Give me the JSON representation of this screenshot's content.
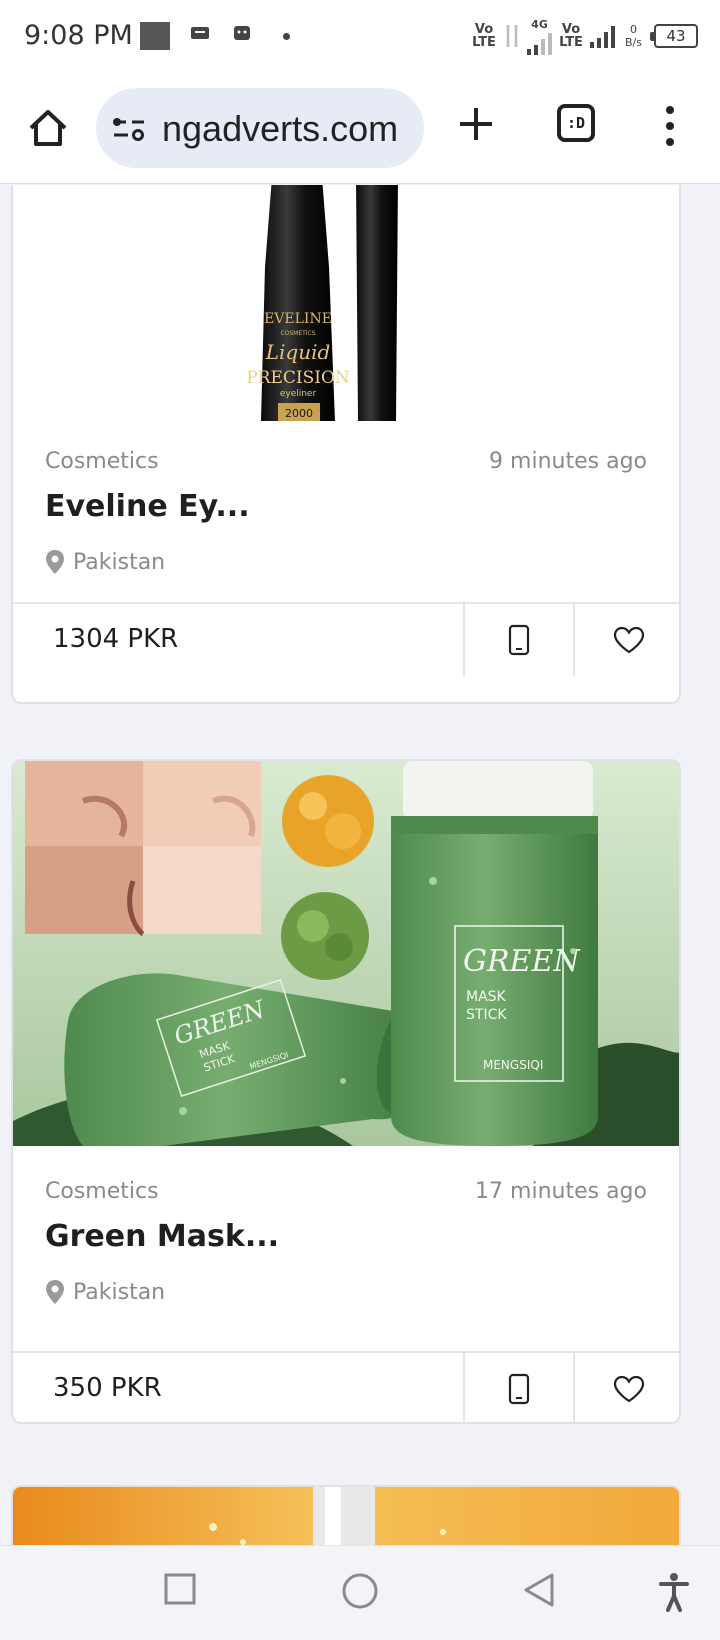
{
  "status_bar": {
    "time": "9:08 PM",
    "lte1": "Vo LTE",
    "network_type": "4G",
    "lte2": "Vo LTE",
    "data_rate_value": "0",
    "data_rate_unit": "B/s",
    "battery": "43"
  },
  "browser": {
    "url": "ngadverts.com",
    "tabs_label": ":D"
  },
  "listings": [
    {
      "category": "Cosmetics",
      "time_ago": "9 minutes ago",
      "title": "Eveline Ey...",
      "location": "Pakistan",
      "price": "1304 PKR",
      "image_text": {
        "brand": "EVELINE",
        "sub": "COSMETICS",
        "line1": "Liquid",
        "line2": "PRECISION",
        "line3": "eyeliner",
        "line4": "2000"
      }
    },
    {
      "category": "Cosmetics",
      "time_ago": "17 minutes ago",
      "title": "Green Mask...",
      "location": "Pakistan",
      "price": "350 PKR",
      "image_text": {
        "line1": "GREEN",
        "line2": "MASK",
        "line3": "STICK",
        "brand": "MENGSIQI"
      }
    }
  ],
  "colors": {
    "page_bg": "#f1f2f7",
    "url_pill": "#e6ebf6",
    "muted_text": "#8a8a8a",
    "mask_green": "#6fa36c"
  },
  "icons": [
    "home-icon",
    "site-settings-icon",
    "plus-icon",
    "tab-switcher-icon",
    "overflow-menu-icon",
    "location-pin-icon",
    "phone-icon",
    "heart-icon",
    "recents-icon",
    "home-circle-icon",
    "back-icon",
    "accessibility-icon"
  ]
}
